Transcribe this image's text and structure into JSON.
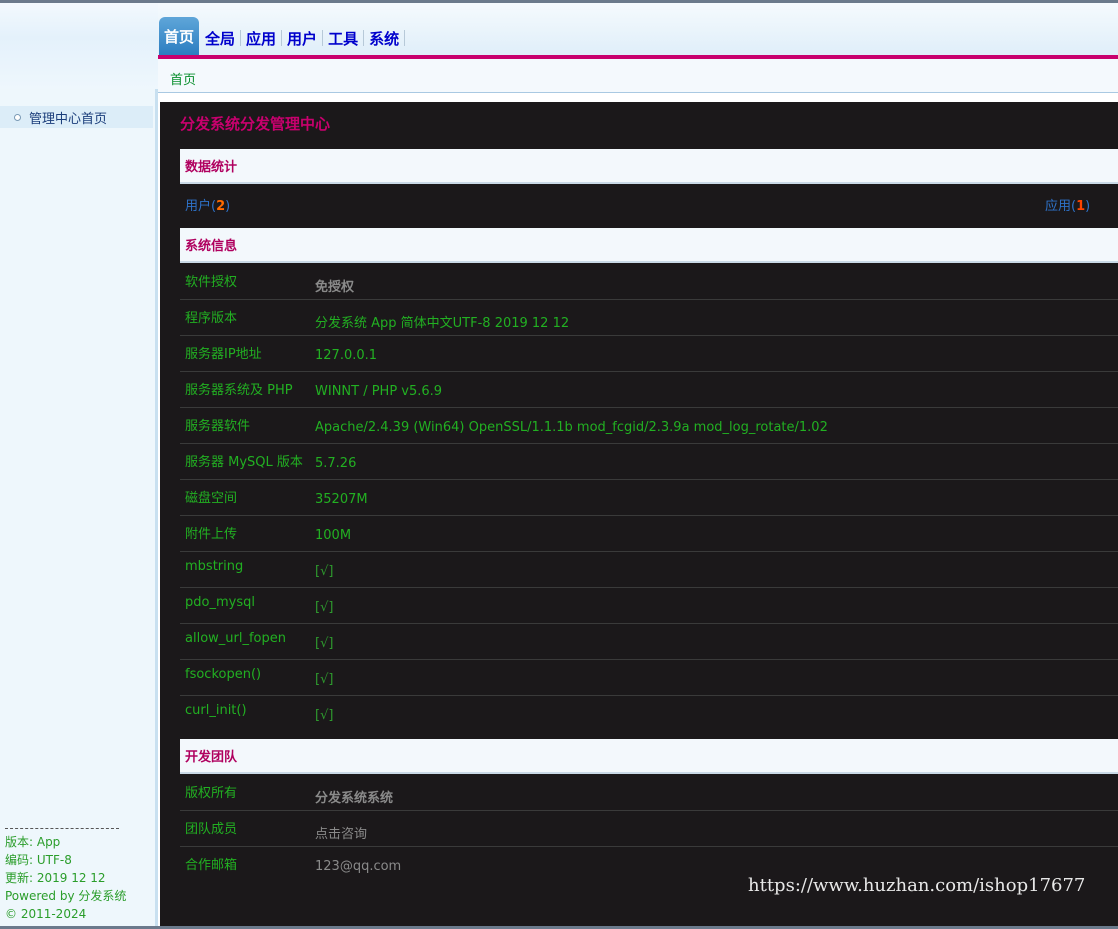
{
  "nav": {
    "tabs": [
      {
        "label": "首页",
        "active": true
      },
      {
        "label": "全局",
        "active": false
      },
      {
        "label": "应用",
        "active": false
      },
      {
        "label": "用户",
        "active": false
      },
      {
        "label": "工具",
        "active": false
      },
      {
        "label": "系统",
        "active": false
      }
    ],
    "breadcrumb": "首页"
  },
  "sidebar": {
    "items": [
      {
        "label": "管理中心首页"
      }
    ],
    "footer": {
      "version": "版本: App",
      "encoding": "编码: UTF-8",
      "updated": "更新: 2019 12 12",
      "powered": "Powered by 分发系统",
      "copyright": "© 2011-2024"
    }
  },
  "main": {
    "title": "分发系统分发管理中心",
    "stats": {
      "heading": "数据统计",
      "users_label": "用户",
      "users_count": "2",
      "apps_label": "应用",
      "apps_count": "1"
    },
    "sysinfo": {
      "heading": "系统信息",
      "rows": [
        {
          "key": "软件授权",
          "value": "免授权"
        },
        {
          "key": "程序版本",
          "value": "分发系统 App 简体中文UTF-8 2019 12 12"
        },
        {
          "key": "服务器IP地址",
          "value": "127.0.0.1"
        },
        {
          "key": "服务器系统及 PHP",
          "value": "WINNT / PHP v5.6.9"
        },
        {
          "key": "服务器软件",
          "value": "Apache/2.4.39 (Win64) OpenSSL/1.1.1b mod_fcgid/2.3.9a mod_log_rotate/1.02"
        },
        {
          "key": "服务器 MySQL 版本",
          "value": "5.7.26"
        },
        {
          "key": "磁盘空间",
          "value": "35207M"
        },
        {
          "key": "附件上传",
          "value": "100M"
        },
        {
          "key": "mbstring",
          "value": "[√]"
        },
        {
          "key": "pdo_mysql",
          "value": "[√]"
        },
        {
          "key": "allow_url_fopen",
          "value": "[√]"
        },
        {
          "key": "fsockopen()",
          "value": "[√]"
        },
        {
          "key": "curl_init()",
          "value": "[√]"
        }
      ]
    },
    "team": {
      "heading": "开发团队",
      "rows": [
        {
          "key": "版权所有",
          "value": "分发系统系统"
        },
        {
          "key": "团队成员",
          "value": "点击咨询"
        },
        {
          "key": "合作邮箱",
          "value": "123@qq.com"
        }
      ]
    }
  },
  "watermark": "https://www.huzhan.com/ishop17677",
  "colors": {
    "accent": "#c8006e",
    "content_bg": "#1b181a",
    "green_text": "#22b022",
    "link_blue": "#2e72c9"
  }
}
